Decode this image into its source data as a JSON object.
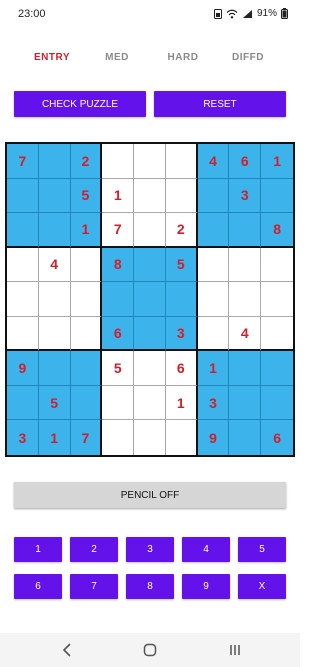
{
  "status_bar": {
    "time": "23:00",
    "battery": "91%"
  },
  "tabs": [
    {
      "label": "ENTRY",
      "active": true
    },
    {
      "label": "MED",
      "active": false
    },
    {
      "label": "HARD",
      "active": false
    },
    {
      "label": "DIFFD",
      "active": false
    }
  ],
  "actions": {
    "check_label": "CHECK PUZZLE",
    "reset_label": "RESET"
  },
  "board": {
    "rows": [
      [
        "7",
        "",
        "2",
        "",
        "",
        "",
        "4",
        "6",
        "1"
      ],
      [
        "",
        "",
        "5",
        "1",
        "",
        "",
        "",
        "3",
        ""
      ],
      [
        "",
        "",
        "1",
        "7",
        "",
        "2",
        "",
        "",
        "8"
      ],
      [
        "",
        "4",
        "",
        "8",
        "",
        "5",
        "",
        "",
        ""
      ],
      [
        "",
        "",
        "",
        "",
        "",
        "",
        "",
        "",
        ""
      ],
      [
        "",
        "",
        "",
        "6",
        "",
        "3",
        "",
        "4",
        ""
      ],
      [
        "9",
        "",
        "",
        "5",
        "",
        "6",
        "1",
        "",
        ""
      ],
      [
        "",
        "5",
        "",
        "",
        "",
        "1",
        "3",
        "",
        ""
      ],
      [
        "3",
        "1",
        "7",
        "",
        "",
        "",
        "9",
        "",
        "6"
      ]
    ],
    "shaded_boxes": [
      0,
      2,
      4,
      6,
      8
    ],
    "shade_color": "#3db3ec",
    "digit_color": "#d21f2b"
  },
  "pencil": {
    "label": "PENCIL OFF"
  },
  "keypad": {
    "keys": [
      "1",
      "2",
      "3",
      "4",
      "5",
      "6",
      "7",
      "8",
      "9",
      "X"
    ]
  },
  "navbar": {
    "icons": [
      "back-icon",
      "home-icon",
      "recents-icon"
    ]
  },
  "colors": {
    "accent": "#6412ea",
    "active_tab": "#d21f2b",
    "inactive_tab": "#8a8a8a"
  }
}
